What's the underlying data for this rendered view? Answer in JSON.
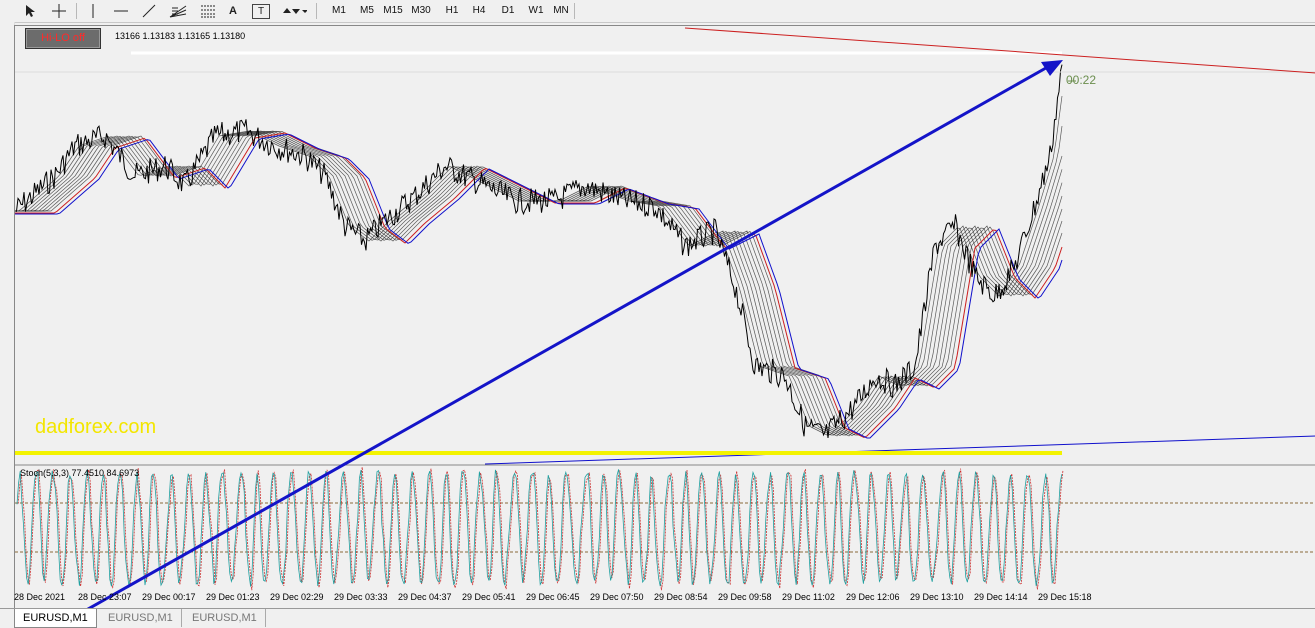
{
  "toolbar": {
    "timeframes": [
      "M1",
      "M5",
      "M15",
      "M30",
      "H1",
      "H4",
      "D1",
      "W1",
      "MN"
    ],
    "icons": [
      "cursor-icon",
      "crosshair-icon",
      "vertical-line-icon",
      "horizontal-line-icon",
      "trendline-icon",
      "fibonacci-fan-icon",
      "fibonacci-retracement-icon",
      "text-icon",
      "text-label-icon",
      "arrows-icon"
    ],
    "tool_letters": {
      "text": "A",
      "label": "T"
    }
  },
  "chart": {
    "ohlc": "13166 1.13183 1.13165 1.13180",
    "hilo_button": "Hi-LO off",
    "timer": "00:22",
    "watermark": "dadforex.com",
    "stoch_label": "Stoch(5,3,3) 77.4510 84.6973",
    "colors": {
      "background": "#f0f0f0",
      "price": "#000000",
      "ma_red": "#cc2020",
      "ma_blue": "#1010cc",
      "arrow": "#1414c8",
      "support": "#f3f300",
      "resistance": "#cc2020",
      "stoch_main": "#20a0a0",
      "stoch_signal": "#cc3030"
    }
  },
  "time_axis": [
    "28 Dec 2021",
    "28 Dec 23:07",
    "29 Dec 00:17",
    "29 Dec 01:23",
    "29 Dec 02:29",
    "29 Dec 03:33",
    "29 Dec 04:37",
    "29 Dec 05:41",
    "29 Dec 06:45",
    "29 Dec 07:50",
    "29 Dec 08:54",
    "29 Dec 09:58",
    "29 Dec 11:02",
    "29 Dec 12:06",
    "29 Dec 13:10",
    "29 Dec 14:14",
    "29 Dec 15:18"
  ],
  "tabs": [
    {
      "label": "EURUSD,M1",
      "active": true
    },
    {
      "label": "EURUSD,M1",
      "active": false
    },
    {
      "label": "EURUSD,M1",
      "active": false
    }
  ]
}
